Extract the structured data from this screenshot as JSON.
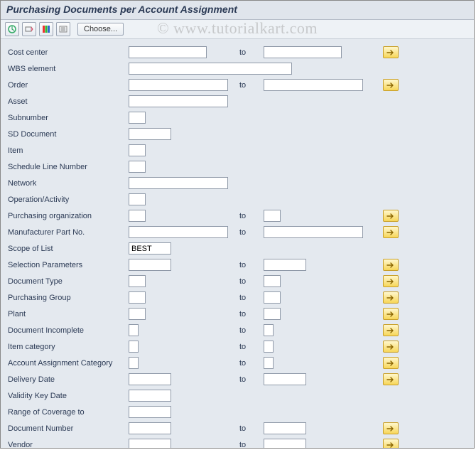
{
  "title": "Purchasing Documents per Account Assignment",
  "watermark": "© www.tutorialkart.com",
  "toolbar": {
    "choose_label": "Choose..."
  },
  "labels": {
    "to": "to"
  },
  "fields": [
    {
      "key": "cost_center",
      "label": "Cost center",
      "low": "",
      "low_size": "lg",
      "has_to": true,
      "high": "",
      "high_size": "lg",
      "multi": true
    },
    {
      "key": "wbs_element",
      "label": "WBS element",
      "low": "",
      "low_size": "xxl",
      "has_to": false,
      "multi": false
    },
    {
      "key": "order",
      "label": "Order",
      "low": "",
      "low_size": "xl",
      "has_to": true,
      "high": "",
      "high_size": "xl",
      "multi": true
    },
    {
      "key": "asset",
      "label": "Asset",
      "low": "",
      "low_size": "xl",
      "has_to": false,
      "multi": false
    },
    {
      "key": "subnumber",
      "label": "Subnumber",
      "low": "",
      "low_size": "sm",
      "has_to": false,
      "multi": false
    },
    {
      "key": "sd_document",
      "label": "SD Document",
      "low": "",
      "low_size": "md",
      "has_to": false,
      "multi": false
    },
    {
      "key": "item",
      "label": "Item",
      "low": "",
      "low_size": "sm",
      "has_to": false,
      "multi": false
    },
    {
      "key": "sched_line",
      "label": "Schedule Line Number",
      "low": "",
      "low_size": "sm",
      "has_to": false,
      "multi": false
    },
    {
      "key": "network",
      "label": "Network",
      "low": "",
      "low_size": "xl",
      "has_to": false,
      "multi": false
    },
    {
      "key": "operation",
      "label": "Operation/Activity",
      "low": "",
      "low_size": "sm",
      "has_to": false,
      "multi": false
    },
    {
      "key": "purch_org",
      "label": "Purchasing organization",
      "low": "",
      "low_size": "sm",
      "has_to": true,
      "high": "",
      "high_size": "sm",
      "multi": true
    },
    {
      "key": "manuf_part",
      "label": "Manufacturer Part No.",
      "low": "",
      "low_size": "xl",
      "has_to": true,
      "high": "",
      "high_size": "xl",
      "multi": true
    },
    {
      "key": "scope_list",
      "label": "Scope of List",
      "low": "BEST",
      "low_size": "md",
      "has_to": false,
      "multi": false
    },
    {
      "key": "sel_params",
      "label": "Selection Parameters",
      "low": "",
      "low_size": "md",
      "has_to": true,
      "high": "",
      "high_size": "md",
      "multi": true
    },
    {
      "key": "doc_type",
      "label": "Document Type",
      "low": "",
      "low_size": "sm",
      "has_to": true,
      "high": "",
      "high_size": "sm",
      "multi": true
    },
    {
      "key": "purch_group",
      "label": "Purchasing Group",
      "low": "",
      "low_size": "sm",
      "has_to": true,
      "high": "",
      "high_size": "sm",
      "multi": true
    },
    {
      "key": "plant",
      "label": "Plant",
      "low": "",
      "low_size": "sm",
      "has_to": true,
      "high": "",
      "high_size": "sm",
      "multi": true
    },
    {
      "key": "doc_incomplete",
      "label": "Document Incomplete",
      "low": "",
      "low_size": "sm",
      "has_to": true,
      "high": "",
      "high_size": "sm",
      "multi": true,
      "tiny": true
    },
    {
      "key": "item_cat",
      "label": "Item category",
      "low": "",
      "low_size": "sm",
      "has_to": true,
      "high": "",
      "high_size": "sm",
      "multi": true,
      "tiny": true
    },
    {
      "key": "acct_assign_cat",
      "label": "Account Assignment Category",
      "low": "",
      "low_size": "sm",
      "has_to": true,
      "high": "",
      "high_size": "sm",
      "multi": true,
      "tiny": true
    },
    {
      "key": "delivery_date",
      "label": "Delivery Date",
      "low": "",
      "low_size": "md",
      "has_to": true,
      "high": "",
      "high_size": "md",
      "multi": true
    },
    {
      "key": "validity_key",
      "label": "Validity Key Date",
      "low": "",
      "low_size": "md",
      "has_to": false,
      "multi": false
    },
    {
      "key": "range_coverage",
      "label": "Range of Coverage to",
      "low": "",
      "low_size": "md",
      "has_to": false,
      "multi": false
    },
    {
      "key": "doc_number",
      "label": "Document Number",
      "low": "",
      "low_size": "md",
      "has_to": true,
      "high": "",
      "high_size": "md",
      "multi": true
    },
    {
      "key": "vendor",
      "label": "Vendor",
      "low": "",
      "low_size": "md",
      "has_to": true,
      "high": "",
      "high_size": "md",
      "multi": true
    }
  ]
}
